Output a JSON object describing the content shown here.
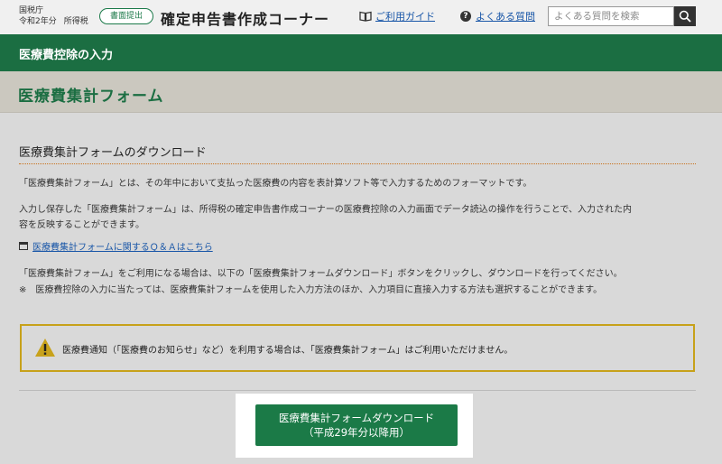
{
  "header": {
    "agency": "国税庁",
    "year": "令和2年分",
    "tax_type": "所得税",
    "mode_badge": "書面提出",
    "app_title": "確定申告書作成コーナー",
    "guide_link": "ご利用ガイド",
    "faq_link": "よくある質問",
    "search_placeholder": "よくある質問を検索",
    "icons": {
      "guide": "book-icon",
      "faq": "question-circle-icon",
      "search": "magnifier-icon"
    }
  },
  "section_band": "医療費控除の入力",
  "page_title": "医療費集計フォーム",
  "main": {
    "subtitle": "医療費集計フォームのダウンロード",
    "para1": "「医療費集計フォーム」とは、その年中において支払った医療費の内容を表計算ソフト等で入力するためのフォーマットです。",
    "para2_line1": "入力し保存した「医療費集計フォーム」は、所得税の確定申告書作成コーナーの医療費控除の入力画面でデータ読込の操作を行うことで、入力された内",
    "para2_line2": "容を反映することができます。",
    "qa_link": "医療費集計フォームに関するＱ＆Ａはこちら",
    "para3": "「医療費集計フォーム」をご利用になる場合は、以下の「医療費集計フォームダウンロード」ボタンをクリックし、ダウンロードを行ってください。",
    "note": "※　医療費控除の入力に当たっては、医療費集計フォームを使用した入力方法のほか、入力項目に直接入力する方法も選択することができます。",
    "notice": "医療費通知（「医療費のお知らせ」など）を利用する場合は、「医療費集計フォーム」はご利用いただけません。",
    "download_button_line1": "医療費集計フォームダウンロード",
    "download_button_line2": "（平成29年分以降用）"
  },
  "colors": {
    "brand_green": "#1b6e42",
    "warning": "#c7a11a",
    "link": "#1a57a8"
  }
}
